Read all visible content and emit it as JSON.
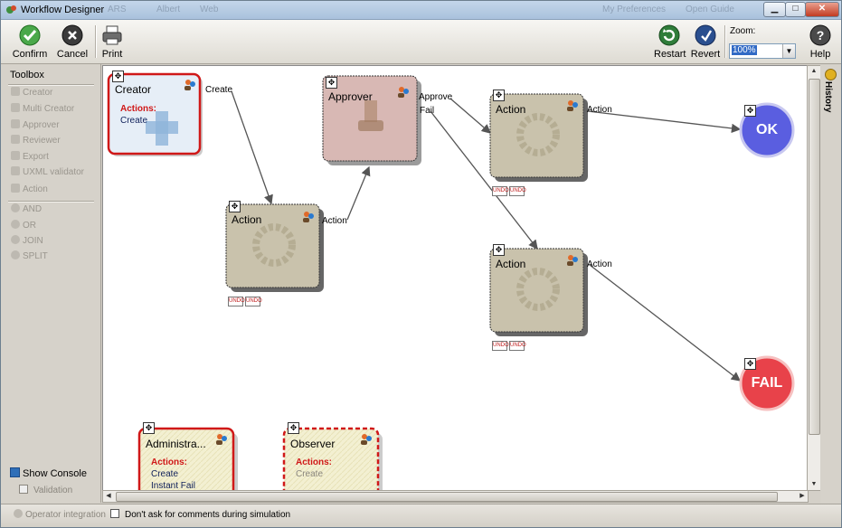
{
  "window": {
    "title": "Workflow Designer",
    "ghost_items": [
      "ARS",
      "Albert",
      "Web",
      "My Preferences",
      "Open Guide"
    ]
  },
  "toolbar": {
    "confirm_label": "Confirm",
    "cancel_label": "Cancel",
    "print_label": "Print",
    "restart_label": "Restart",
    "revert_label": "Revert",
    "zoom_label": "Zoom:",
    "zoom_value": "100%",
    "help_label": "Help"
  },
  "toolbox": {
    "header": "Toolbox",
    "items": [
      "Creator",
      "Multi Creator",
      "Approver",
      "Reviewer",
      "Export",
      "UXML validator",
      "Action"
    ],
    "logic_items": [
      "AND",
      "OR",
      "JOIN",
      "SPLIT"
    ],
    "show_console": "Show Console",
    "validation": "Validation"
  },
  "history_label": "History",
  "status": {
    "operator_integration": "Operator integration",
    "dont_ask": "Don't ask for comments during simulation"
  },
  "nodes": {
    "creator": {
      "label": "Creator",
      "actions_header": "Actions:",
      "actions": [
        "Create"
      ]
    },
    "approver": {
      "label": "Approver"
    },
    "action1": {
      "label": "Action"
    },
    "action2": {
      "label": "Action"
    },
    "action3": {
      "label": "Action"
    },
    "ok": {
      "label": "OK"
    },
    "fail": {
      "label": "FAIL"
    },
    "administrator": {
      "label": "Administra...",
      "actions_header": "Actions:",
      "actions": [
        "Create",
        "Instant Fail"
      ]
    },
    "observer": {
      "label": "Observer",
      "actions_header": "Actions:",
      "actions": [
        "Create"
      ]
    }
  },
  "edges": {
    "create": "Create",
    "action1_out": "Action",
    "approve": "Approve",
    "fail": "Fail",
    "action2_out": "Action",
    "action3_out": "Action"
  },
  "port_label": "UNDO",
  "colors": {
    "ok": "#5a5ee0",
    "fail": "#e8424a",
    "creator_border": "#d01818",
    "action_fill": "#c9c2ac",
    "approver_fill": "#d8b8b4"
  }
}
